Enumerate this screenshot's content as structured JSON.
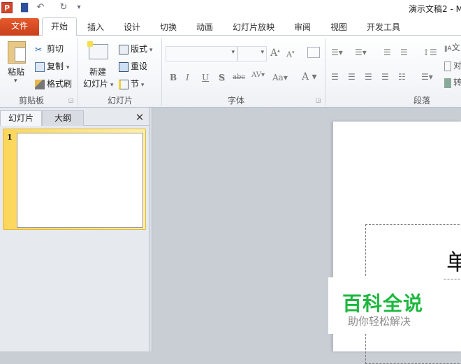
{
  "title_bar": {
    "document_title": "演示文稿2 - M"
  },
  "quick_access": {
    "app_icon": "P",
    "save": "save-icon",
    "undo": "undo-icon",
    "redo": "redo-icon",
    "customize": "customize-icon"
  },
  "tabs": [
    "文件",
    "开始",
    "插入",
    "设计",
    "切换",
    "动画",
    "幻灯片放映",
    "审阅",
    "视图",
    "开发工具"
  ],
  "ribbon": {
    "clipboard": {
      "label": "剪贴板",
      "paste": "粘贴",
      "cut": "剪切",
      "copy": "复制",
      "format_painter": "格式刷"
    },
    "slides": {
      "label": "幻灯片",
      "new_slide_1": "新建",
      "new_slide_2": "幻灯片",
      "layout": "版式",
      "reset": "重设",
      "section": "节"
    },
    "font": {
      "label": "字体",
      "font_name": "",
      "font_size": ""
    },
    "paragraph": {
      "label": "段落",
      "text_dir": "文",
      "align_text": "对",
      "convert": "转"
    }
  },
  "left_panel": {
    "tab_slides": "幻灯片",
    "tab_outline": "大纲",
    "close": "✕",
    "slide_number": "1"
  },
  "slide": {
    "title_partial": "单"
  },
  "watermark": {
    "title": "百科全说",
    "subtitle": "助你轻松解决",
    "color": "#1db83f"
  }
}
